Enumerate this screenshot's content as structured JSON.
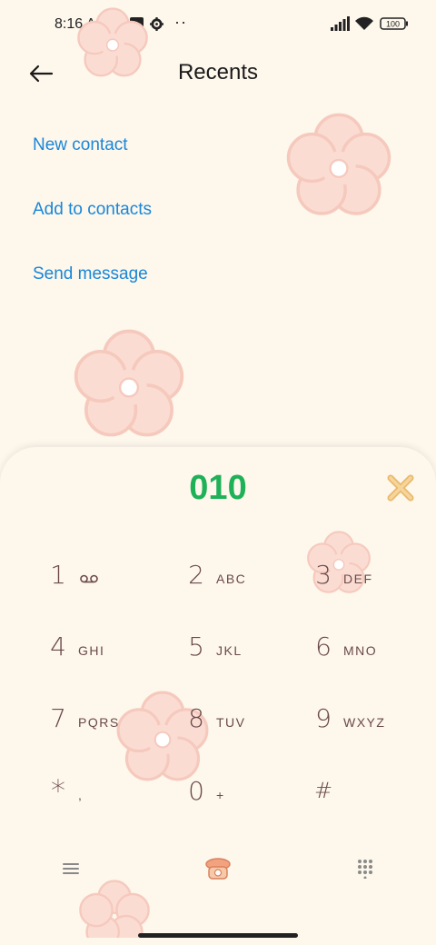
{
  "status_bar": {
    "time": "8:16 AM",
    "battery": "100",
    "overflow_dots": "··"
  },
  "header": {
    "title": "Recents",
    "back_icon": "arrow-left-icon"
  },
  "actions": [
    {
      "label": "New contact"
    },
    {
      "label": "Add to contacts"
    },
    {
      "label": "Send message"
    }
  ],
  "dialpad": {
    "entered_number": "010",
    "keys": [
      {
        "digit": "1",
        "letters": "",
        "icon": "voicemail-icon"
      },
      {
        "digit": "2",
        "letters": "ABC"
      },
      {
        "digit": "3",
        "letters": "DEF"
      },
      {
        "digit": "4",
        "letters": "GHI"
      },
      {
        "digit": "5",
        "letters": "JKL"
      },
      {
        "digit": "6",
        "letters": "MNO"
      },
      {
        "digit": "7",
        "letters": "PQRS"
      },
      {
        "digit": "8",
        "letters": "TUV"
      },
      {
        "digit": "9",
        "letters": "WXYZ"
      },
      {
        "digit": "*",
        "letters": ","
      },
      {
        "digit": "0",
        "letters": "+"
      },
      {
        "digit": "#",
        "letters": ""
      }
    ]
  },
  "colors": {
    "background": "#fdf7ec",
    "link": "#1a86d8",
    "number": "#1fb158",
    "key_text": "#6b4a4a",
    "flower": "#fbdcd3"
  }
}
